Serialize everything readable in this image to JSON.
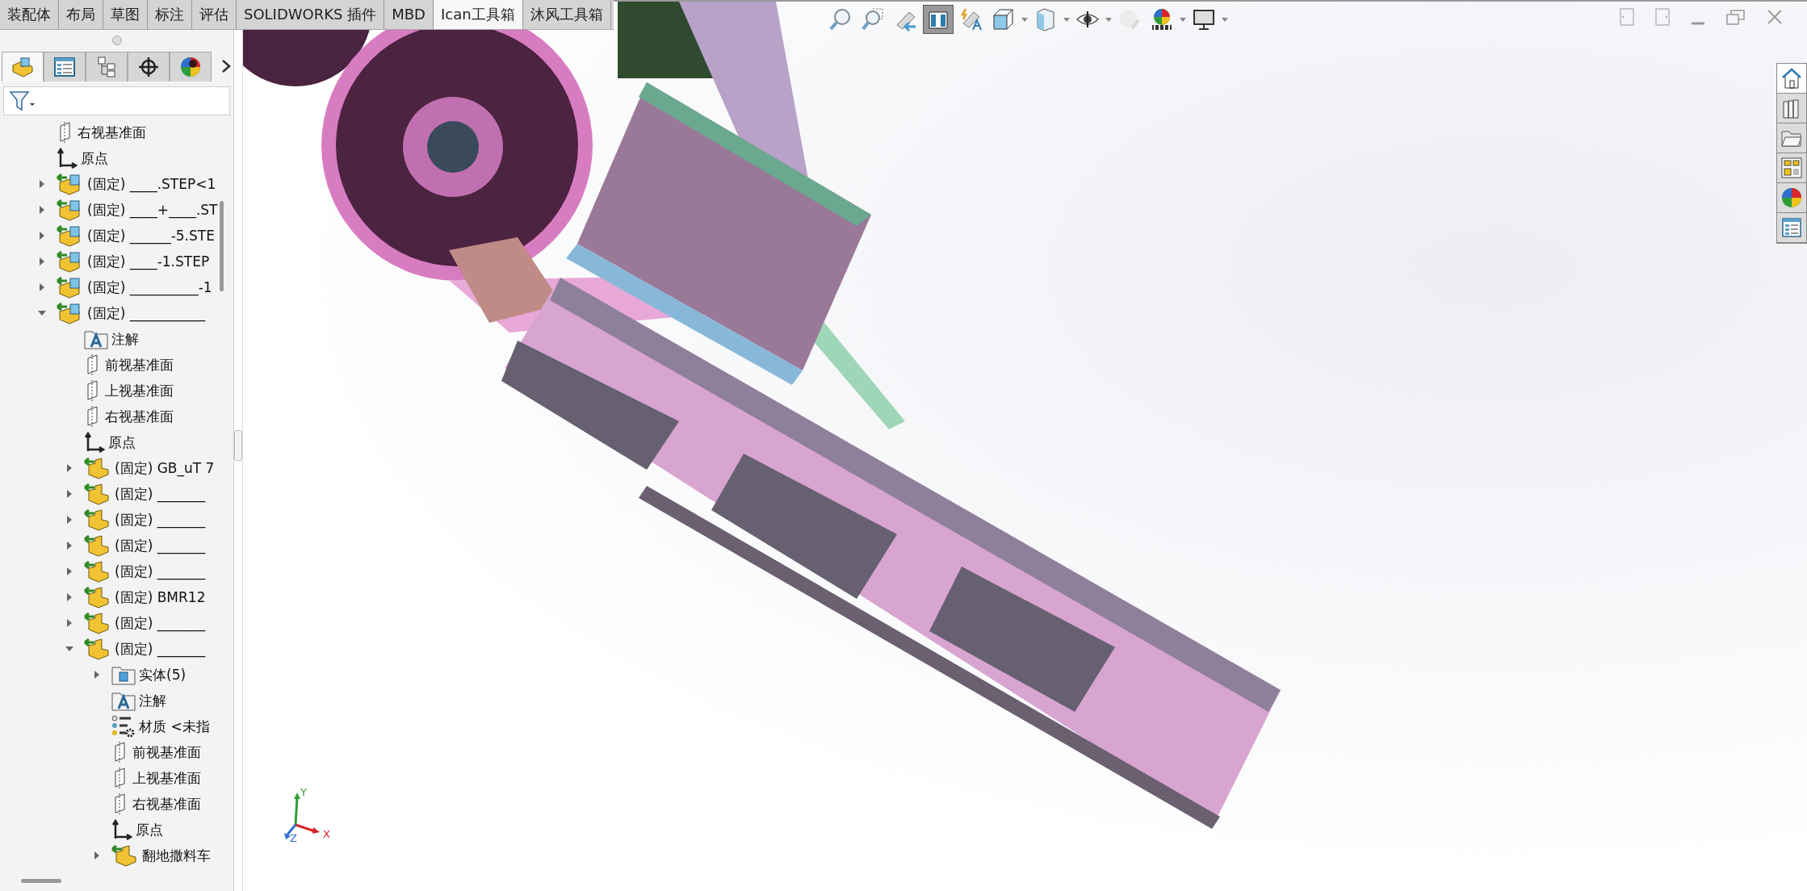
{
  "command_tabs": [
    {
      "label": "装配体",
      "selected": false
    },
    {
      "label": "布局",
      "selected": false
    },
    {
      "label": "草图",
      "selected": false
    },
    {
      "label": "标注",
      "selected": false
    },
    {
      "label": "评估",
      "selected": false
    },
    {
      "label": "SOLIDWORKS 插件",
      "selected": false
    },
    {
      "label": "MBD",
      "selected": false
    },
    {
      "label": "Ican工具箱",
      "selected": true
    },
    {
      "label": "沐风工具箱",
      "selected": false
    }
  ],
  "panel_tabs": [
    {
      "selected": true
    },
    {
      "selected": false
    },
    {
      "selected": false
    },
    {
      "selected": false
    },
    {
      "selected": false
    }
  ],
  "tree": [
    {
      "kind": "plane",
      "label": "右视基准面"
    },
    {
      "kind": "origin",
      "label": "原点"
    },
    {
      "kind": "assembly",
      "label": "(固定) ____.STEP<1",
      "expanded": false
    },
    {
      "kind": "assembly",
      "label": "(固定) ____+____.ST",
      "expanded": false
    },
    {
      "kind": "assembly",
      "label": "(固定) ______-5.STE",
      "expanded": false
    },
    {
      "kind": "assembly",
      "label": "(固定) ____-1.STEP",
      "expanded": false
    },
    {
      "kind": "assembly",
      "label": "(固定) __________-1",
      "expanded": false
    },
    {
      "kind": "assembly",
      "label": "(固定) ___________",
      "expanded": true,
      "children": [
        {
          "kind": "annotations",
          "label": "注解"
        },
        {
          "kind": "plane",
          "label": "前视基准面"
        },
        {
          "kind": "plane",
          "label": "上视基准面"
        },
        {
          "kind": "plane",
          "label": "右视基准面"
        },
        {
          "kind": "origin",
          "label": "原点"
        },
        {
          "kind": "part",
          "label": "(固定) GB_uT 7",
          "expanded": false
        },
        {
          "kind": "part",
          "label": "(固定) _______",
          "expanded": false
        },
        {
          "kind": "part",
          "label": "(固定) _______",
          "expanded": false
        },
        {
          "kind": "part",
          "label": "(固定) _______",
          "expanded": false
        },
        {
          "kind": "part",
          "label": "(固定) _______",
          "expanded": false
        },
        {
          "kind": "part",
          "label": "(固定) BMR12",
          "expanded": false
        },
        {
          "kind": "part",
          "label": "(固定) _______",
          "expanded": false
        },
        {
          "kind": "part",
          "label": "(固定) _______",
          "expanded": true,
          "children": [
            {
              "kind": "bodies",
              "label": "实体(5)",
              "expanded": false
            },
            {
              "kind": "annotations",
              "label": "注解"
            },
            {
              "kind": "material",
              "label": "材质 <未指"
            },
            {
              "kind": "plane",
              "label": "前视基准面"
            },
            {
              "kind": "plane",
              "label": "上视基准面"
            },
            {
              "kind": "plane",
              "label": "右视基准面"
            },
            {
              "kind": "origin",
              "label": "原点"
            },
            {
              "kind": "part",
              "label": "翻地撒料车",
              "expanded": false
            }
          ]
        }
      ]
    }
  ],
  "view_toolbar": [
    {
      "selected": false
    },
    {
      "selected": false
    },
    {
      "selected": false
    },
    {
      "selected": true
    },
    {
      "selected": false
    },
    {
      "selected": false
    },
    {
      "selected": false
    },
    {
      "selected": false
    },
    {
      "selected": false
    },
    {
      "selected": false
    },
    {
      "selected": false
    }
  ],
  "task_pane": [
    {
      "selected": true
    },
    {
      "selected": false
    },
    {
      "selected": false
    },
    {
      "selected": false
    },
    {
      "selected": false
    },
    {
      "selected": false
    }
  ],
  "triad": {
    "x": "X",
    "y": "Y",
    "z": "Z"
  }
}
